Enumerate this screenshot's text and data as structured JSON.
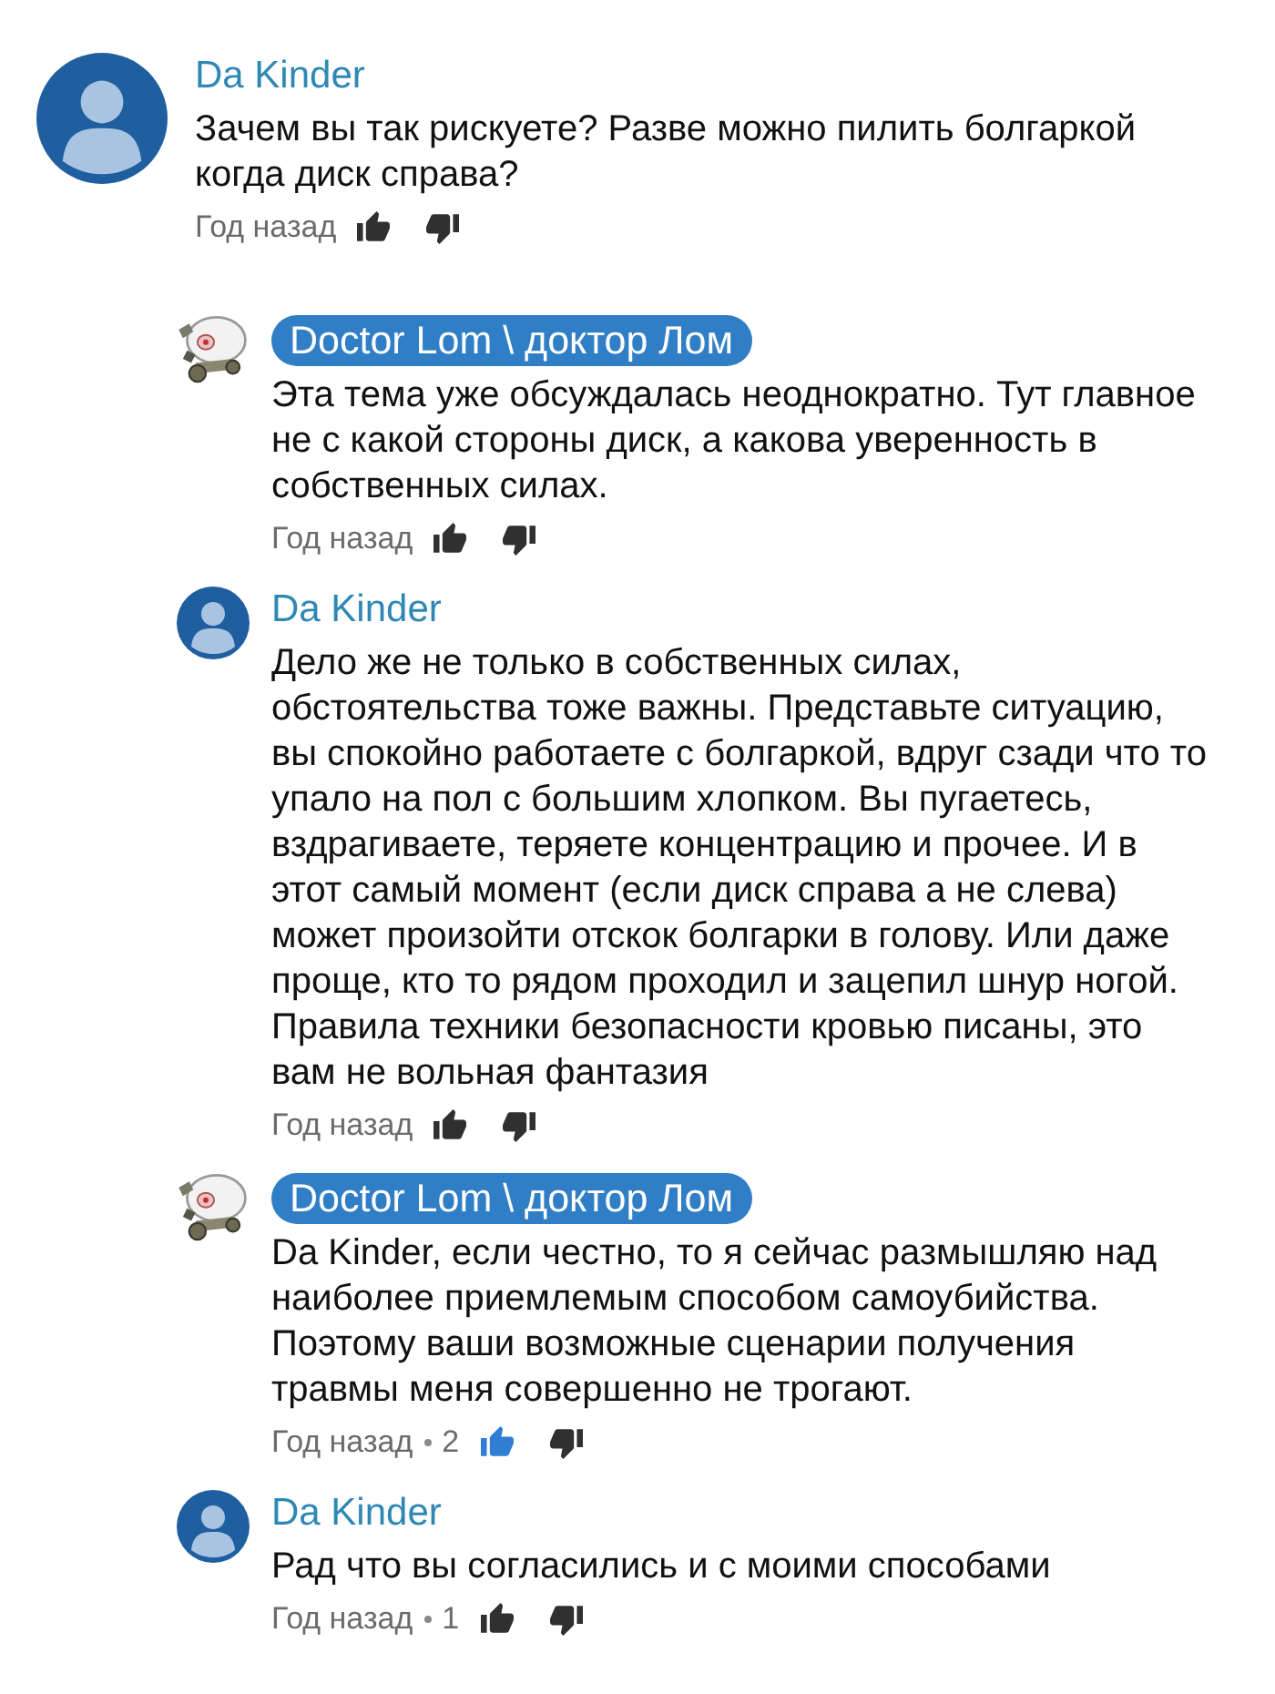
{
  "thread": {
    "comment": {
      "kind": "user",
      "author": "Da Kinder",
      "text": "Зачем вы так рискуете? Разве можно пилить болгаркой когда диск справа?",
      "time": "Год назад",
      "liked": false
    },
    "replies": [
      {
        "kind": "owner",
        "author": "Doctor Lom \\ доктор Лом",
        "text": "Эта тема уже обсуждалась неоднократно. Тут главное не с какой стороны диск, а какова уверенность в собственных силах.",
        "time": "Год назад",
        "liked": false
      },
      {
        "kind": "user",
        "author": "Da Kinder",
        "text": "Дело же не только в собственных силах, обстоятельства тоже важны. Представьте ситуацию, вы спокойно работаете с болгаркой, вдруг сзади что то упало на пол с большим хлопком. Вы пугаетесь, вздрагиваете, теряете концентрацию и прочее. И в этот самый момент (если диск справа а не слева) может произойти отскок болгарки в голову. Или даже проще, кто то рядом проходил и зацепил шнур ногой. Правила техники безопасности кровью писаны, это вам не вольная фантазия",
        "time": "Год назад",
        "liked": false
      },
      {
        "kind": "owner",
        "author": "Doctor Lom \\ доктор Лом",
        "text": "Da Kinder, если честно, то я сейчас размышляю над наиболее приемлемым способом самоубийства. Поэтому ваши возможные сценарии получения травмы меня совершенно не трогают.",
        "time": "Год назад",
        "likes": "2",
        "liked": true
      },
      {
        "kind": "user",
        "author": "Da Kinder",
        "text": "Рад что вы согласились и с моими способами",
        "time": "Год назад",
        "likes": "1",
        "liked": false
      }
    ]
  }
}
